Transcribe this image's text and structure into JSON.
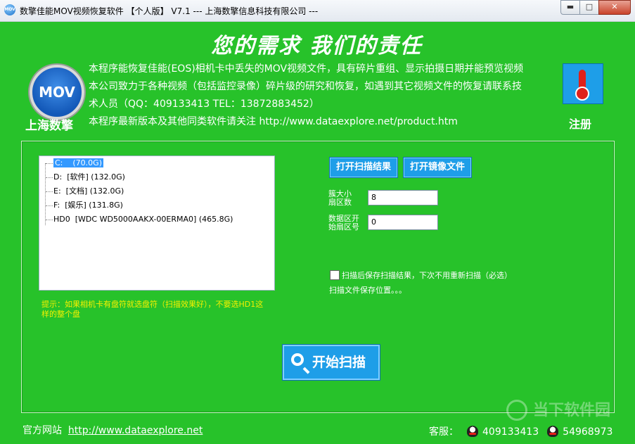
{
  "window": {
    "title": "数擎佳能MOV视频恢复软件  【个人版】 V7.1  --- 上海数擎信息科技有限公司 ---",
    "minimize": "▬",
    "maximize": "□",
    "close": "✕"
  },
  "header": {
    "slogan": "您的需求  我们的责任",
    "logo_text": "MOV",
    "company": "上海数擎",
    "desc_line1": "本程序能恢复佳能(EOS)相机卡中丢失的MOV视频文件，具有碎片重组、显示拍摄日期并能预览视频",
    "desc_line2": "本公司致力于各种视频（包括监控录像）碎片级的研究和恢复，如遇到其它视频文件的恢复请联系技",
    "desc_line3": "术人员（QQ：409133413  TEL：13872883452）",
    "desc_line4": "本程序最新版本及其他同类软件请关注 http://www.dataexplore.net/product.htm",
    "register_label": "注册"
  },
  "drives": [
    {
      "letter": "C:",
      "label": "",
      "size": "(70.0G)"
    },
    {
      "letter": "D:",
      "label": "[软件]",
      "size": "(132.0G)"
    },
    {
      "letter": "E:",
      "label": "[文档]",
      "size": "(132.0G)"
    },
    {
      "letter": "F:",
      "label": "[娱乐]",
      "size": "(131.8G)"
    },
    {
      "letter": "HD0",
      "label": "[WDC WD5000AAKX-00ERMA0]",
      "size": "(465.8G)"
    }
  ],
  "hint": "提示：如果相机卡有盘符就选盘符（扫描效果好），不要选HD1这样的整个盘",
  "actions": {
    "open_scan": "打开扫描结果",
    "open_image": "打开镜像文件",
    "max_sector_label": "簇大小扇区数",
    "max_sector_value": "8",
    "start_sector_label": "数据区开始扇区号",
    "start_sector_value": "0",
    "save_checkbox_label": "扫描后保存扫描结果，下次不用重新扫描（必选）",
    "save_location": "扫描文件保存位置。。。",
    "start_scan": "开始扫描"
  },
  "footer": {
    "site_label": "官方网站",
    "site_url": "http://www.dataexplore.net",
    "support_label": "客服：",
    "qq1": "409133413",
    "qq2": "54968973"
  },
  "watermark": "当下软件园"
}
